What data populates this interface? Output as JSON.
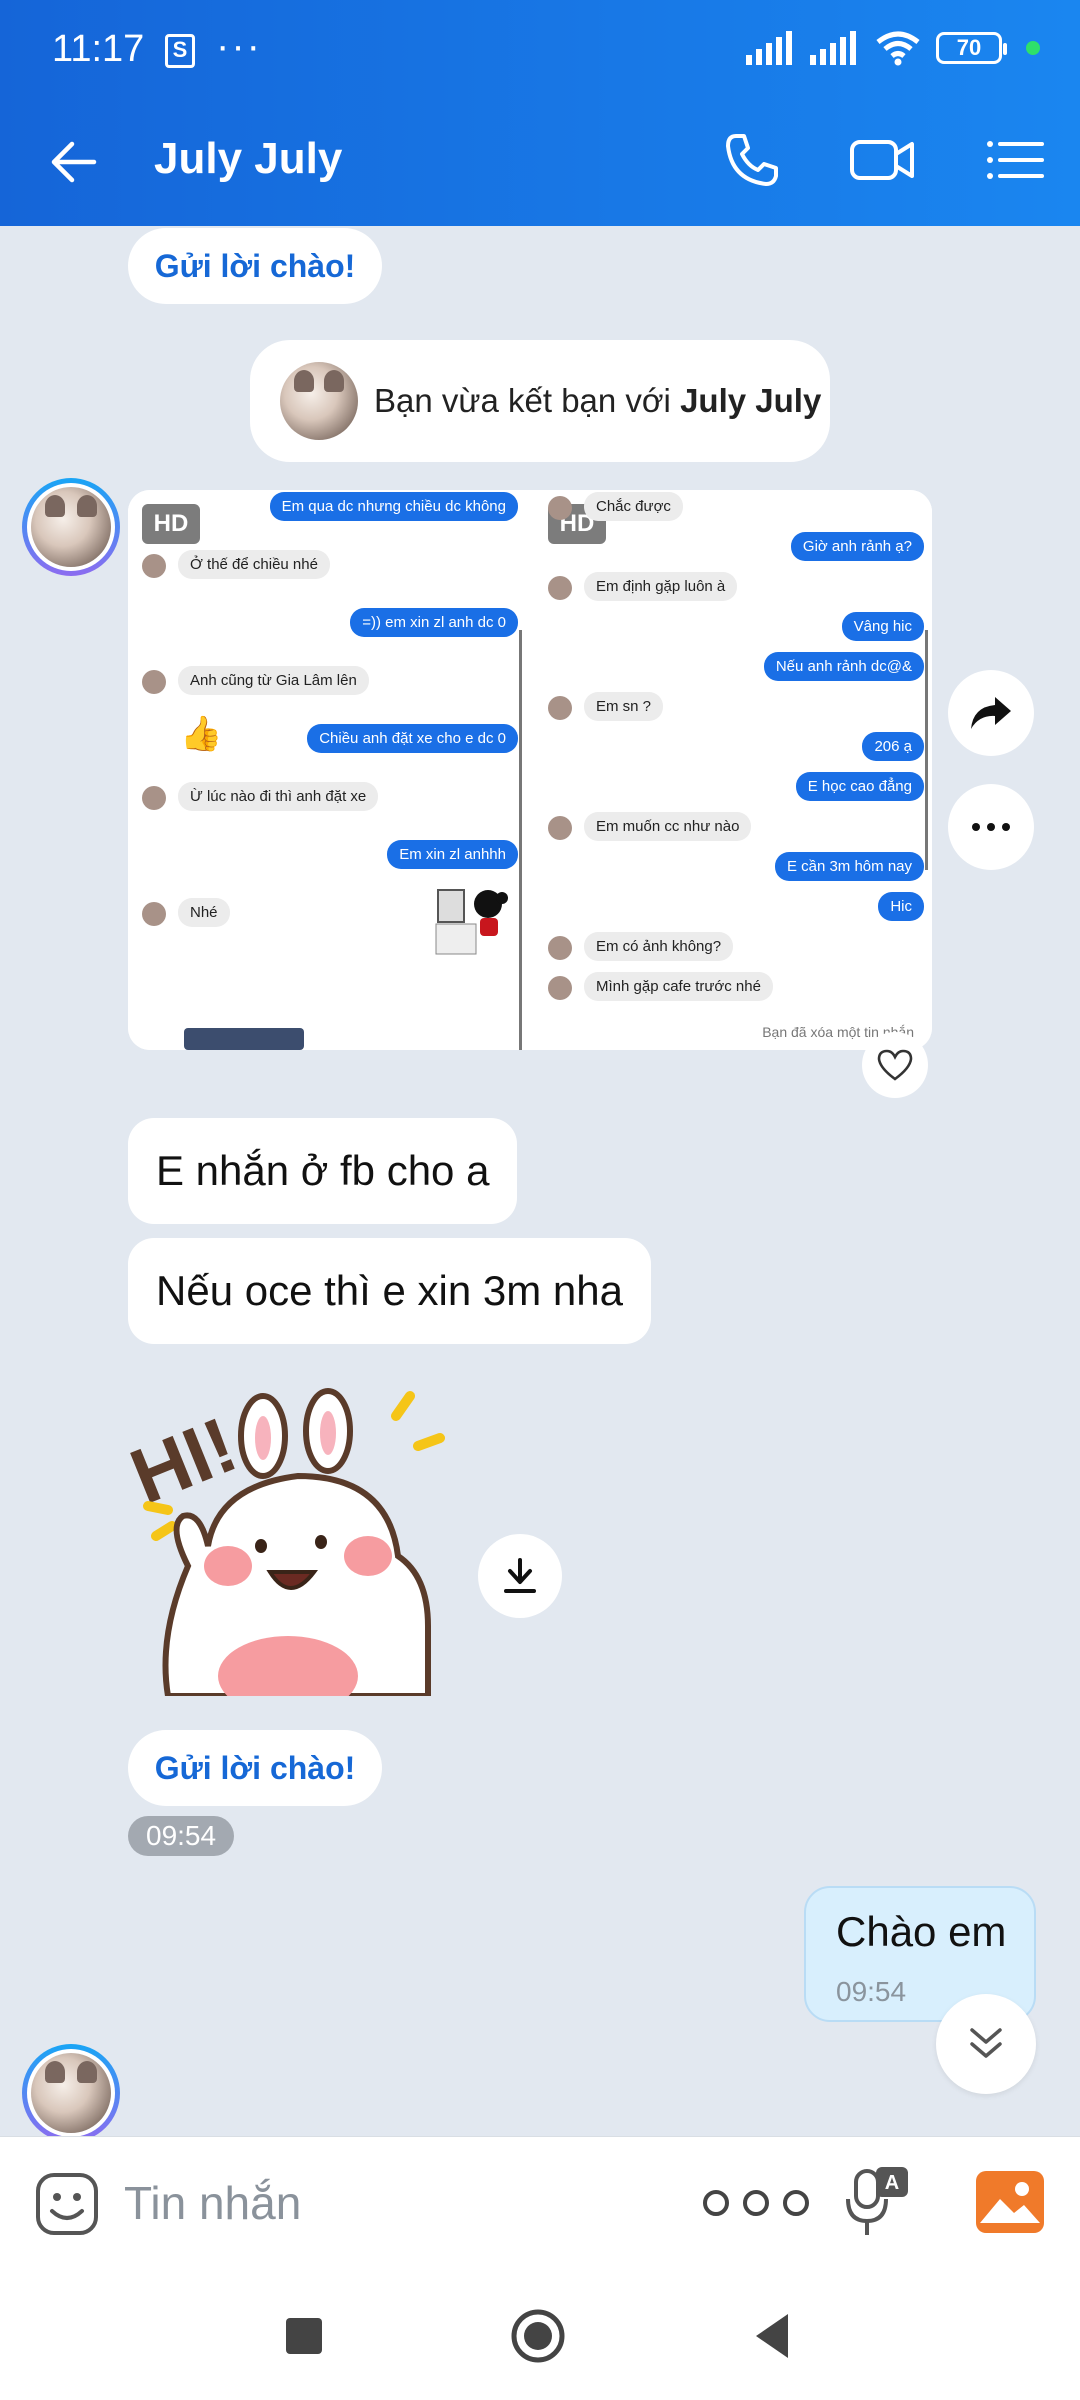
{
  "status_bar": {
    "time": "11:17",
    "shop_icon_glyph": "S",
    "dots": "···",
    "battery": "70",
    "icons": [
      "shopee-bag-icon",
      "signal-icon",
      "signal-icon",
      "wifi-icon",
      "battery-icon"
    ]
  },
  "header": {
    "title": "July July",
    "icons": [
      "back-arrow-icon",
      "phone-call-icon",
      "video-call-icon",
      "menu-list-icon"
    ]
  },
  "chat": {
    "greeting_button_top": "Gửi lời chào!",
    "system_message": {
      "prefix": "Bạn vừa kết bạn với ",
      "name": "July July"
    },
    "image_message": {
      "left_shot": {
        "hd_label": "HD",
        "bubbles": [
          {
            "side": "r",
            "text": "Em qua dc nhưng chiều dc không"
          },
          {
            "side": "l",
            "text": "Ở thế để chiều nhé"
          },
          {
            "side": "r",
            "text": "=)) em xin zl anh dc 0"
          },
          {
            "side": "l",
            "text": "Anh cũng từ Gia Lâm lên"
          },
          {
            "side": "r",
            "text": "Chiều anh đặt xe cho e dc 0"
          },
          {
            "side": "l",
            "text": "Ừ lúc nào đi thì anh đặt xe"
          },
          {
            "side": "r",
            "text": "Em xin zl anhhh"
          },
          {
            "side": "l",
            "text": "Nhé"
          }
        ]
      },
      "right_shot": {
        "hd_label": "HD",
        "bubbles": [
          {
            "side": "l",
            "text": "Chắc được"
          },
          {
            "side": "r",
            "text": "Giờ anh rảnh ạ?"
          },
          {
            "side": "l",
            "text": "Em định gặp luôn à"
          },
          {
            "side": "r",
            "text": "Vâng hic"
          },
          {
            "side": "r",
            "text": "Nếu anh rảnh dc@&"
          },
          {
            "side": "l",
            "text": "Em sn ?"
          },
          {
            "side": "r",
            "text": "206 ạ"
          },
          {
            "side": "r",
            "text": "E học cao đẳng"
          },
          {
            "side": "l",
            "text": "Em muốn cc như nào"
          },
          {
            "side": "r",
            "text": "E cần 3m hôm nay"
          },
          {
            "side": "r",
            "text": "Hic"
          },
          {
            "side": "l",
            "text": "Em có ảnh không?"
          },
          {
            "side": "l",
            "text": "Mình gặp cafe trước nhé"
          }
        ],
        "deleted_note": "Bạn đã xóa một tin nhắn"
      }
    },
    "incoming_texts": [
      "E nhắn ở fb cho a",
      "Nếu oce thì e xin 3m nha"
    ],
    "sticker_text": "HI!",
    "greeting_button_bottom": "Gửi lời chào!",
    "incoming_time": "09:54",
    "outgoing": {
      "text": "Chào em",
      "time": "09:54"
    }
  },
  "input_bar": {
    "placeholder": "Tin nhắn",
    "icons": [
      "sticker-emoji-icon",
      "more-options-icon",
      "voice-to-text-icon",
      "gallery-icon"
    ]
  },
  "nav_bar": {
    "icons": [
      "recents-square-icon",
      "home-circle-icon",
      "back-triangle-icon"
    ]
  },
  "colors": {
    "header_start": "#1565d8",
    "header_end": "#1a86f0",
    "chat_bg": "#e2e8f0",
    "link_blue": "#1668d6",
    "outgoing_bg": "#d8effd",
    "gallery_orange": "#f07a2a"
  }
}
